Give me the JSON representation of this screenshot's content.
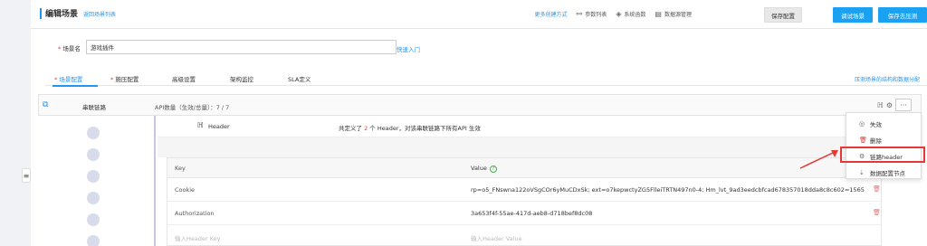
{
  "sidebar": {
    "collapse_icon": "menu-icon"
  },
  "header": {
    "title": "编辑场景",
    "back_link": "返回场景列表",
    "more_link": "更多创建方式",
    "menu": [
      {
        "label": "参数列表",
        "icon": "flow-icon"
      },
      {
        "label": "系统函数",
        "icon": "cube-icon"
      },
      {
        "label": "数据源管理",
        "icon": "database-icon"
      }
    ],
    "buttons": {
      "save": "保存配置",
      "debug": "调试场景",
      "save_press": "保存去压测"
    }
  },
  "scene": {
    "label_required": "*",
    "label": "场景名",
    "name_value": "游戏插件",
    "quick_link": "快速入门"
  },
  "tabs": [
    {
      "label": "场景配置",
      "required": true,
      "active": true
    },
    {
      "label": "施压配置",
      "required": true,
      "active": false
    },
    {
      "label": "高级设置",
      "required": false,
      "active": false
    },
    {
      "label": "架构监控",
      "required": false,
      "active": false
    },
    {
      "label": "SLA定义",
      "required": false,
      "active": false
    }
  ],
  "tabs_right_link": "压测场景的结构和数据分配",
  "chain": {
    "name": "串联链路",
    "api_count_label": "API数量（生效/总量）：7 / 7"
  },
  "header_section": {
    "label": "Header",
    "desc_prefix": "共定义了",
    "desc_num": "2",
    "desc_suffix": "个 Header，对该串联链路下所有API 生效"
  },
  "kv_table": {
    "col_key": "Key",
    "col_value": "Value",
    "col_op": "操",
    "rows": [
      {
        "key": "Cookie",
        "value": "rp=o5_FNswna122oVSgCOr6yMuCDxSk; ext=o7kepwctyZG5FlleiTRTN497n0-4; Hm_lvt_9ad3eedcbfcad678357018dda8c8c602=1565"
      },
      {
        "key": "Authorization",
        "value": "3a653f4f-55ae-417d-aeb8-d718bef8dc08"
      }
    ],
    "placeholder_key": "输入Header Key",
    "placeholder_value": "输入Header Value"
  },
  "dropdown": {
    "items": [
      {
        "label": "失效",
        "icon": "eye-off-icon"
      },
      {
        "label": "删除",
        "icon": "trash-icon"
      },
      {
        "label": "链路header",
        "icon": "gear-icon"
      },
      {
        "label": "数据配置节点",
        "icon": "link-icon"
      }
    ]
  },
  "colors": {
    "accent": "#1aa1f2",
    "required": "#e53935",
    "highlight": "#e53935"
  }
}
